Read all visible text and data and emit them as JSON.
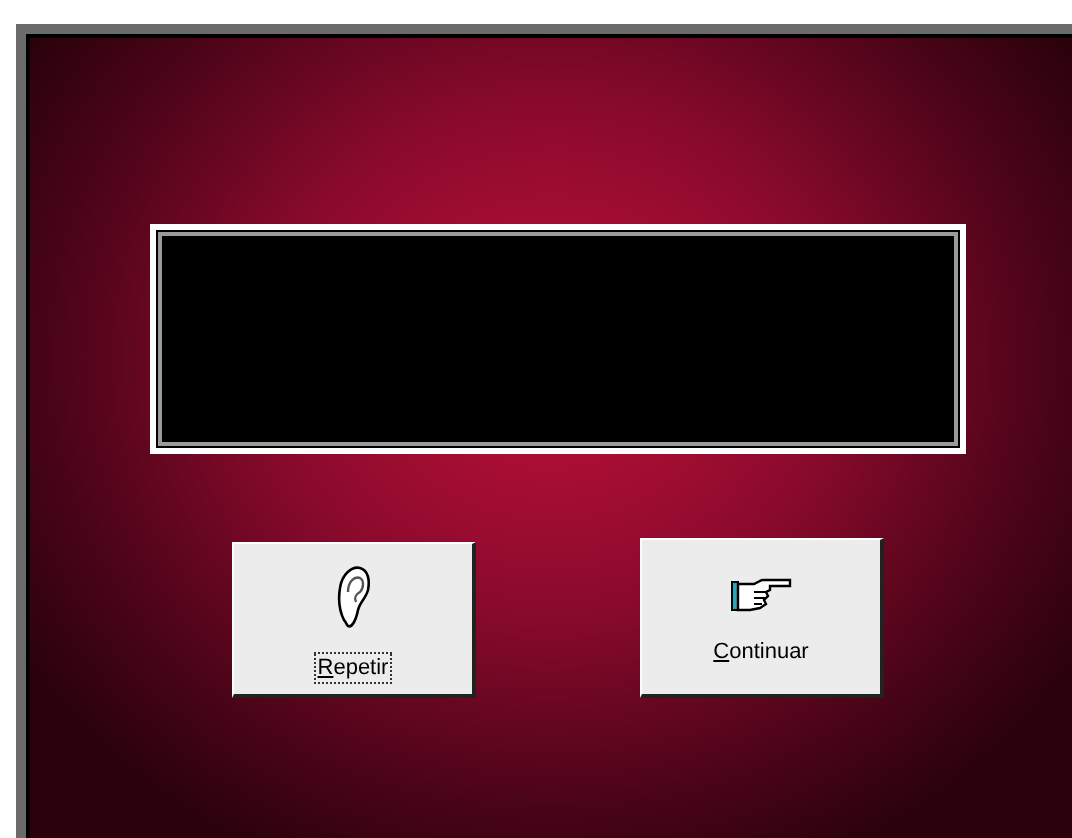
{
  "buttons": [
    {
      "label": "Repetir",
      "kind": "ear",
      "focused": true
    },
    {
      "label": "Continuar",
      "kind": "pointing-hand",
      "focused": false
    }
  ]
}
